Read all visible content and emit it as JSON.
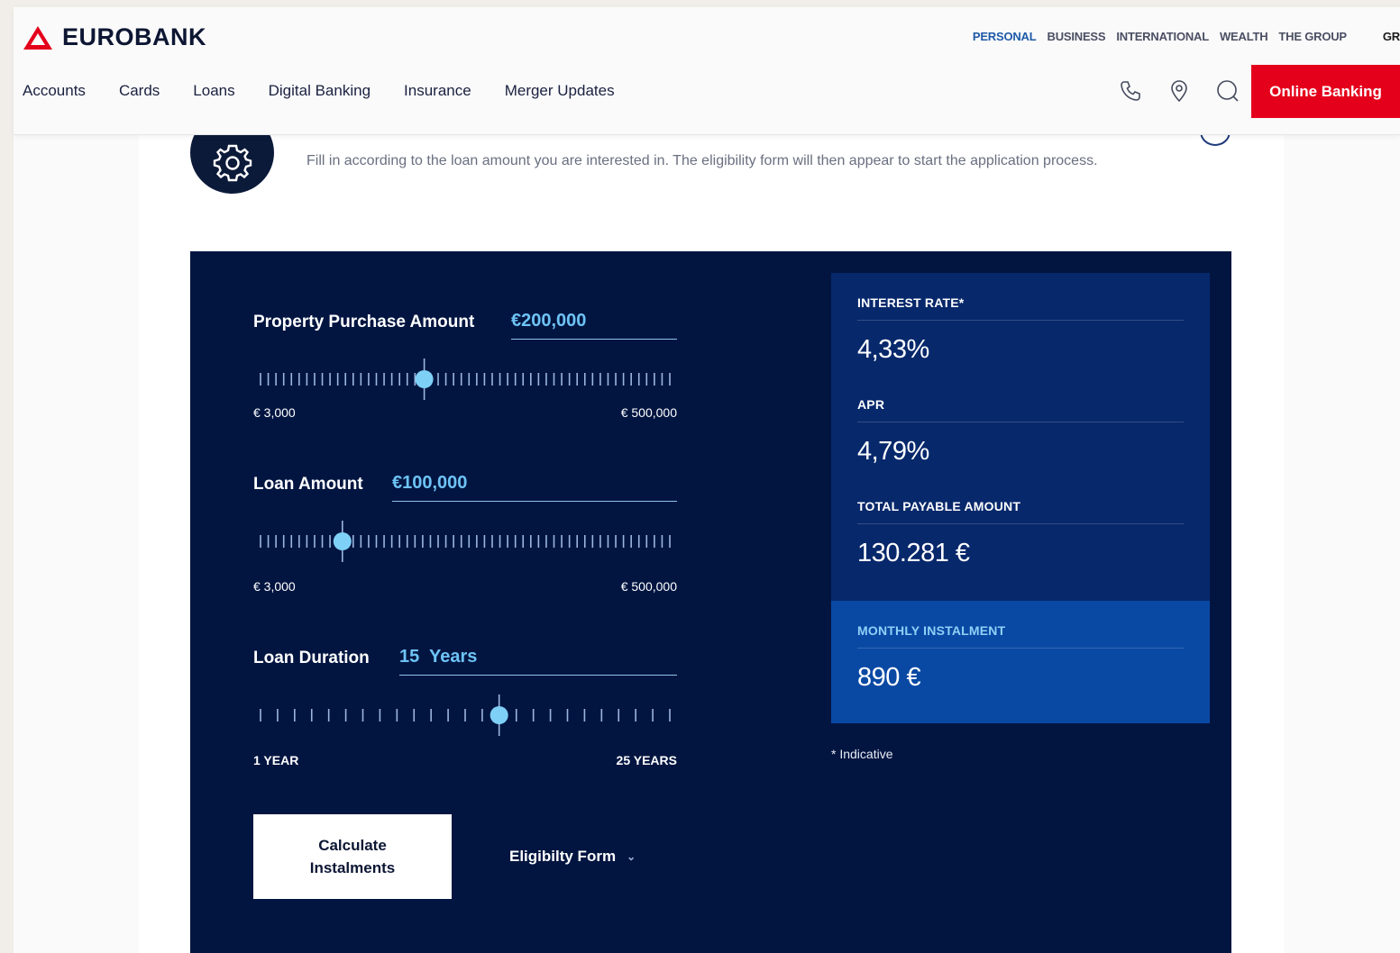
{
  "header": {
    "brand": "EUROBANK",
    "segments": [
      "PERSONAL",
      "BUSINESS",
      "INTERNATIONAL",
      "WEALTH",
      "THE GROUP"
    ],
    "language": "GR",
    "nav": [
      "Accounts",
      "Cards",
      "Loans",
      "Digital Banking",
      "Insurance",
      "Merger Updates"
    ],
    "online_banking": "Online Banking",
    "accent_color": "#e4001b"
  },
  "intro": {
    "text": "Fill in according to the loan amount you are interested in. The eligibility form will then appear to start the application process."
  },
  "calculator": {
    "property": {
      "label": "Property Purchase Amount",
      "value": "€200,000",
      "min": "€ 3,000",
      "max": "€ 500,000",
      "position": 0.4
    },
    "loan": {
      "label": "Loan Amount",
      "value": "€100,000",
      "min": "€ 3,000",
      "max": "€ 500,000",
      "position": 0.2
    },
    "duration": {
      "label": "Loan Duration",
      "value": "15  Years",
      "min": "1 YEAR",
      "max": "25 YEARS",
      "position": 0.583
    },
    "calculate_button": "Calculate Instalments",
    "eligibility": "Eligibilty Form"
  },
  "results": {
    "interest_rate_label": "INTEREST RATE*",
    "interest_rate": "4,33%",
    "apr_label": "APR",
    "apr": "4,79%",
    "total_label": "TOTAL PAYABLE AMOUNT",
    "total": "130.281 €",
    "monthly_label": "MONTHLY INSTALMENT",
    "monthly": "890 €",
    "note": "* Indicative"
  }
}
